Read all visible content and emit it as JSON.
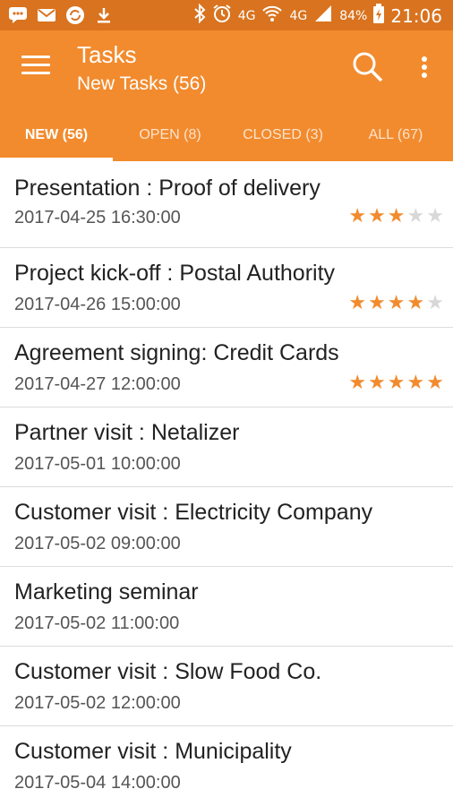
{
  "statusbar": {
    "battery": "84%",
    "time": "21:06",
    "net1": "4G",
    "net2": "4G"
  },
  "appbar": {
    "title": "Tasks",
    "subtitle": "New Tasks (56)"
  },
  "tabs": [
    {
      "label": "NEW (56)"
    },
    {
      "label": "OPEN (8)"
    },
    {
      "label": "CLOSED (3)"
    },
    {
      "label": "ALL (67)"
    }
  ],
  "tasks": [
    {
      "title": "Presentation :  Proof of delivery",
      "date": "2017-04-25 16:30:00",
      "rating": 3
    },
    {
      "title": "Project kick-off : Postal Authority",
      "date": "2017-04-26 15:00:00",
      "rating": 4
    },
    {
      "title": "Agreement signing: Credit Cards",
      "date": "2017-04-27 12:00:00",
      "rating": 5
    },
    {
      "title": "Partner visit : Netalizer",
      "date": "2017-05-01 10:00:00",
      "rating": 0
    },
    {
      "title": "Customer visit : Electricity Company",
      "date": "2017-05-02 09:00:00",
      "rating": 0
    },
    {
      "title": "Marketing seminar",
      "date": "2017-05-02 11:00:00",
      "rating": 0
    },
    {
      "title": "Customer visit : Slow Food Co.",
      "date": "2017-05-02 12:00:00",
      "rating": 0
    },
    {
      "title": "Customer visit : Municipality",
      "date": "2017-05-04 14:00:00",
      "rating": 0
    }
  ],
  "colors": {
    "accent": "#f28b2e",
    "statusbar": "#d9731f"
  }
}
